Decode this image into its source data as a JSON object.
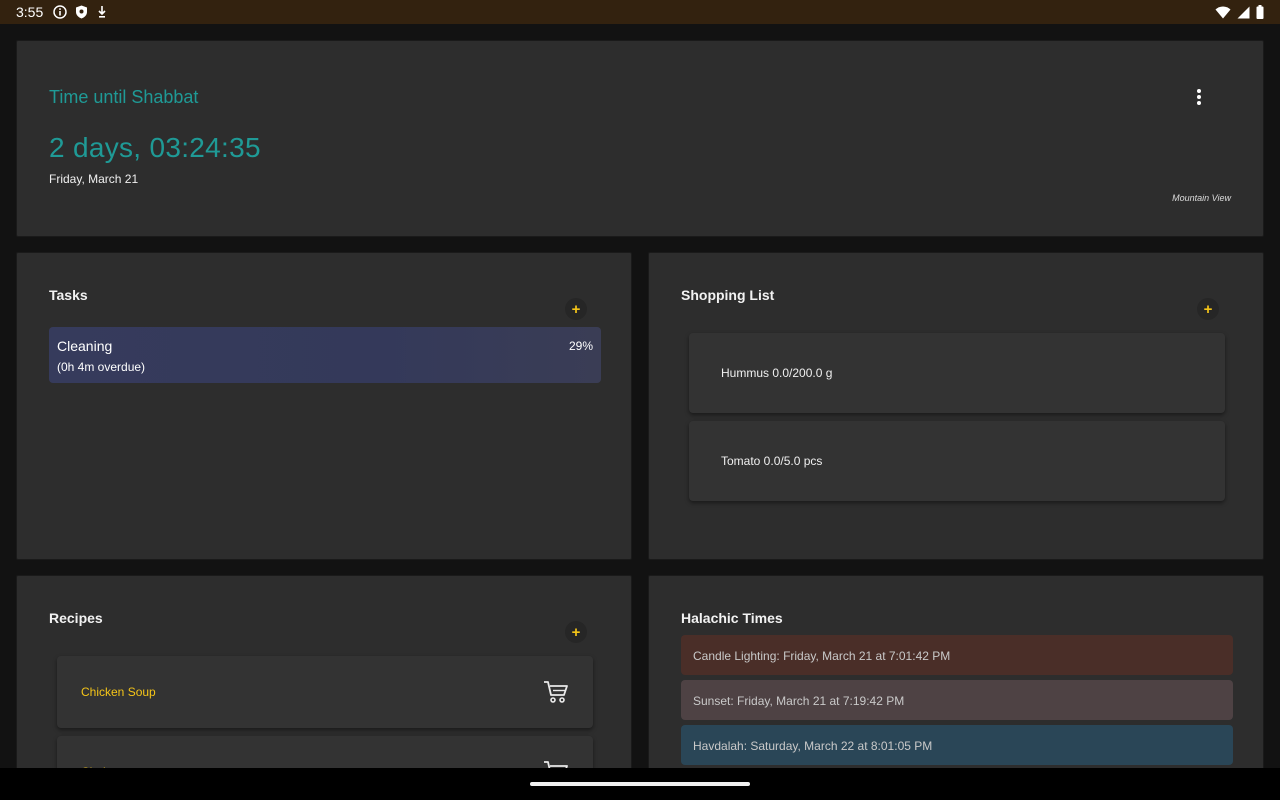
{
  "status_bar": {
    "time": "3:55",
    "left_icons": [
      "info-icon",
      "shield-icon",
      "download-icon"
    ],
    "right_icons": [
      "wifi-icon",
      "cell-signal-icon",
      "battery-icon"
    ]
  },
  "shabbat": {
    "title": "Time until Shabbat",
    "countdown": "2 days, 03:24:35",
    "date": "Friday, March 21",
    "location": "Mountain View",
    "menu_icon": "more-vert-icon",
    "accent_color": "#1f9a96"
  },
  "tasks": {
    "title": "Tasks",
    "add_label": "+",
    "items": [
      {
        "name": "Cleaning",
        "percent": "29%",
        "status": "(0h 4m overdue)"
      }
    ]
  },
  "shopping": {
    "title": "Shopping List",
    "add_label": "+",
    "items": [
      {
        "label": "Hummus 0.0/200.0 g"
      },
      {
        "label": "Tomato 0.0/5.0 pcs"
      }
    ]
  },
  "recipes": {
    "title": "Recipes",
    "add_label": "+",
    "items": [
      {
        "name": "Chicken Soup",
        "icon": "shopping-cart-icon"
      },
      {
        "name": "Chal",
        "icon": "shopping-cart-icon"
      }
    ]
  },
  "halachic": {
    "title": "Halachic Times",
    "items": [
      {
        "label": "Candle Lighting: Friday, March 21 at 7:01:42 PM",
        "color": "#4a2e28"
      },
      {
        "label": "Sunset: Friday, March 21 at 7:19:42 PM",
        "color": "#4e4244"
      },
      {
        "label": "Havdalah: Saturday, March 22 at 8:01:05 PM",
        "color": "#2a4657"
      }
    ]
  },
  "colors": {
    "accent_yellow": "#f5c518",
    "card_bg": "#2d2d2d",
    "app_bg": "#121212",
    "status_bar": "#33220f"
  }
}
